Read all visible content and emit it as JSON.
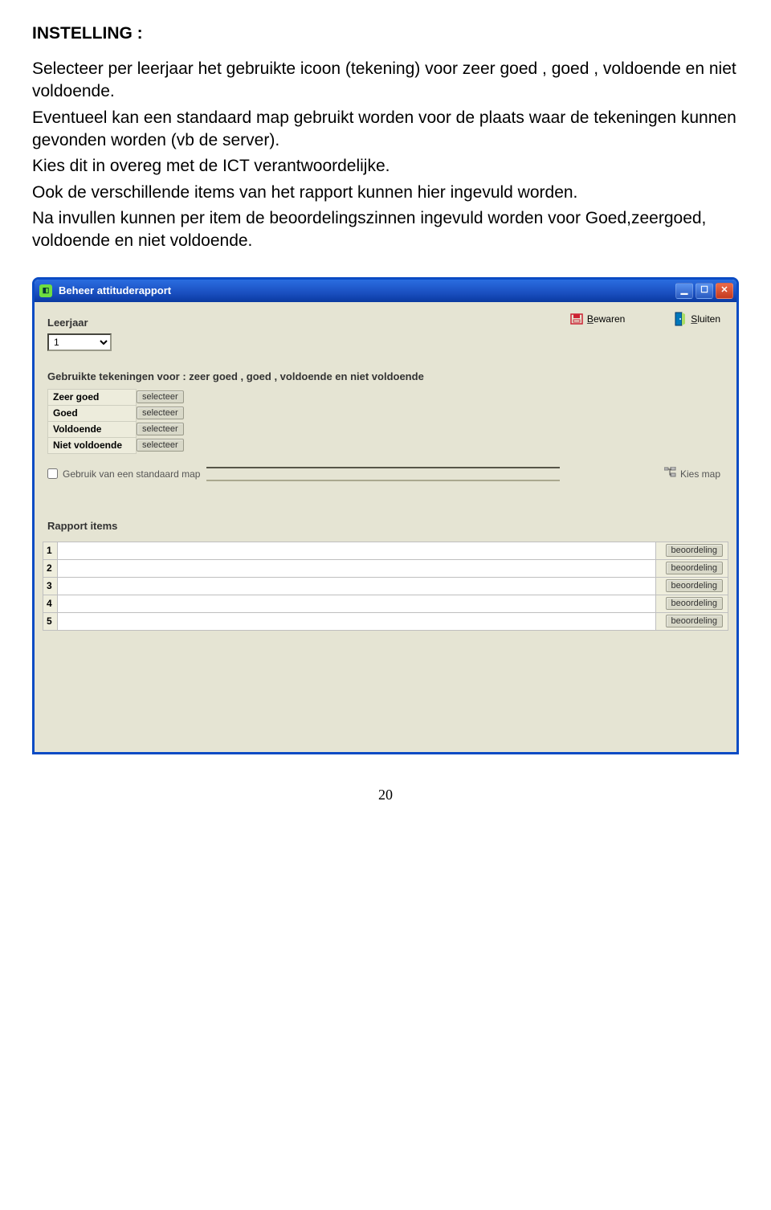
{
  "doc": {
    "heading": "INSTELLING :",
    "para1": "Selecteer per leerjaar het gebruikte icoon (tekening) voor zeer goed , goed , voldoende en niet voldoende.",
    "para2": "Eventueel kan een standaard map gebruikt worden voor de plaats waar de tekeningen kunnen gevonden worden (vb de server).",
    "para3": "Kies dit in overeg met de ICT verantwoordelijke.",
    "para4": "Ook de verschillende items van het rapport kunnen hier ingevuld worden.",
    "para5": "Na invullen kunnen per item de beoordelingszinnen ingevuld worden voor Goed,zeergoed, voldoende en niet voldoende."
  },
  "window": {
    "title": "Beheer attituderapport",
    "min": "_",
    "max": "□",
    "close": "×"
  },
  "toolbar": {
    "bewaren_prefix": "B",
    "bewaren_rest": "ewaren",
    "sluiten_prefix": "S",
    "sluiten_rest": "luiten",
    "kiesmap_prefix": "",
    "kiesmap_label": "Kies map"
  },
  "leerjaar": {
    "label": "Leerjaar",
    "value": "1"
  },
  "tekeningen": {
    "section_label": "Gebruikte tekeningen voor :  zeer goed  ,  goed ,  voldoende en niet voldoende",
    "rows": [
      {
        "label": "Zeer goed",
        "btn": "selecteer"
      },
      {
        "label": "Goed",
        "btn": "selecteer"
      },
      {
        "label": "Voldoende",
        "btn": "selecteer"
      },
      {
        "label": "Niet voldoende",
        "btn": "selecteer"
      }
    ],
    "stdmap_label": "Gebruik van een standaard map",
    "stdmap_value": ""
  },
  "rapport": {
    "label": "Rapport items",
    "rows": [
      {
        "num": "1",
        "value": "",
        "btn": "beoordeling"
      },
      {
        "num": "2",
        "value": "",
        "btn": "beoordeling"
      },
      {
        "num": "3",
        "value": "",
        "btn": "beoordeling"
      },
      {
        "num": "4",
        "value": "",
        "btn": "beoordeling"
      },
      {
        "num": "5",
        "value": "",
        "btn": "beoordeling"
      }
    ]
  },
  "page_number": "20"
}
